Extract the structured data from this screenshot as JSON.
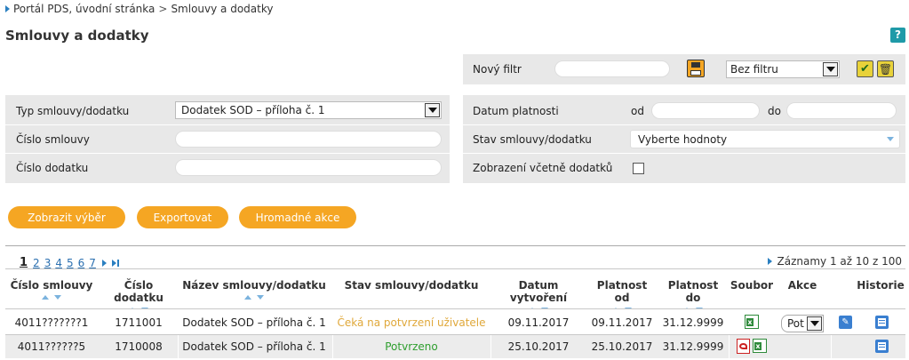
{
  "breadcrumb": {
    "item1": "Portál PDS, úvodní stránka",
    "sep": ">",
    "item2": "Smlouvy a dodatky"
  },
  "page_title": "Smlouvy a dodatky",
  "help_label": "?",
  "filter_bar": {
    "new_filter_label": "Nový filtr",
    "new_filter_value": "",
    "saved_filter_selected": "Bez filtru"
  },
  "form": {
    "contract_type_label": "Typ smlouvy/dodatku",
    "contract_type_value": "Dodatek SOD – příloha č. 1",
    "contract_number_label": "Číslo smlouvy",
    "addendum_number_label": "Číslo dodatku",
    "validity_label": "Datum platnosti",
    "from_label": "od",
    "to_label": "do",
    "status_label": "Stav smlouvy/dodatku",
    "status_placeholder": "Vyberte hodnoty",
    "include_addenda_label": "Zobrazení včetně dodatků"
  },
  "actions": {
    "show": "Zobrazit výběr",
    "export": "Exportovat",
    "bulk": "Hromadné akce"
  },
  "pager": {
    "current": "1",
    "pages": [
      "2",
      "3",
      "4",
      "5",
      "6",
      "7"
    ],
    "records": "Záznamy 1 až 10 z 100"
  },
  "table": {
    "headers": [
      "Číslo smlouvy",
      "Číslo dodatku",
      "Název smlouvy/dodatku",
      "Stav smlouvy/dodatku",
      "Datum vytvoření",
      "Platnost od",
      "Platnost do",
      "Soubor",
      "Akce",
      "Historie"
    ],
    "rows": [
      {
        "contract": "4011???????1",
        "addendum": "1711001",
        "name": "Dodatek SOD – příloha č. 1",
        "status": "Čeká na potvrzení uživatele",
        "created": "09.11.2017",
        "valid_from": "09.11.2017",
        "valid_to": "31.12.9999",
        "action_value": "Pot"
      },
      {
        "contract": "4011??????5",
        "addendum": "1710008",
        "name": "Dodatek SOD – příloha č. 1",
        "status": "Potvrzeno",
        "created": "25.10.2017",
        "valid_from": "25.10.2017",
        "valid_to": "31.12.9999"
      }
    ]
  },
  "colors": {
    "accent": "#f5a623",
    "pending": "#e0a83a",
    "confirmed": "#2e9e2e",
    "panel": "#e8e8e8",
    "link": "#2a6fb0"
  },
  "icons": [
    "excel-icon",
    "pdf-icon",
    "edit-icon",
    "history-icon",
    "save-icon",
    "confirm-icon",
    "delete-icon"
  ]
}
